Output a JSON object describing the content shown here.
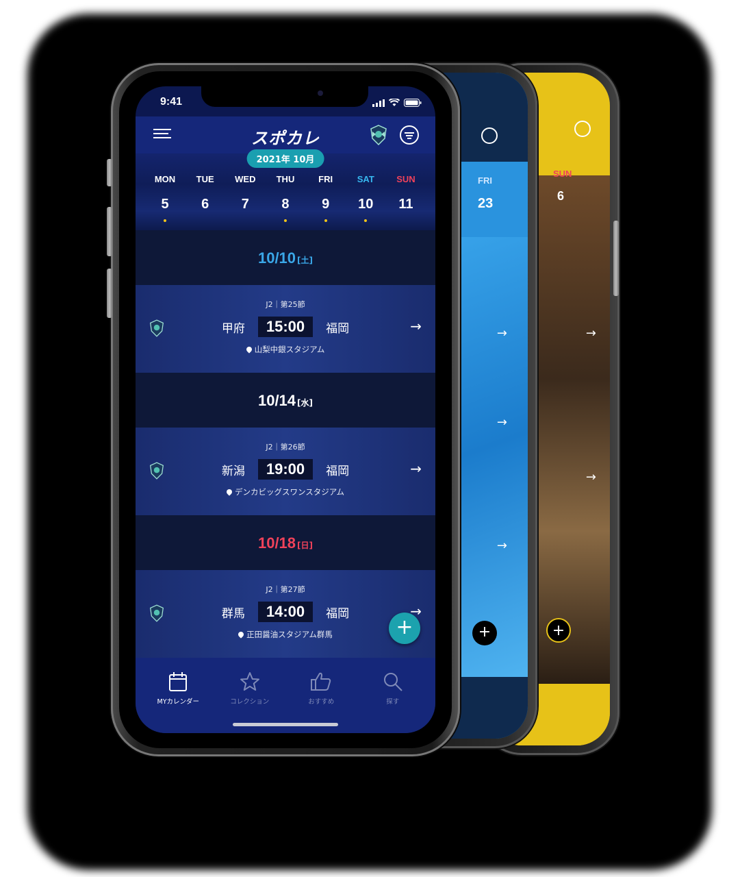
{
  "status": {
    "time": "9:41"
  },
  "app": {
    "logo_text": "スポカレ"
  },
  "calendar": {
    "month_label": "2021年 10月",
    "weekdays": [
      "MON",
      "TUE",
      "WED",
      "THU",
      "FRI",
      "SAT",
      "SUN"
    ],
    "dates": [
      "5",
      "6",
      "7",
      "8",
      "9",
      "10",
      "11"
    ],
    "selected": "8"
  },
  "schedule": [
    {
      "date": "10/10",
      "day": "[土]",
      "league": "J2｜第25節",
      "home": "甲府",
      "time": "15:00",
      "away": "福岡",
      "venue": "山梨中銀スタジアム"
    },
    {
      "date": "10/14",
      "day": "[水]",
      "league": "J2｜第26節",
      "home": "新潟",
      "time": "19:00",
      "away": "福岡",
      "venue": "デンカビッグスワンスタジアム"
    },
    {
      "date": "10/18",
      "day": "[日]",
      "league": "J2｜第27節",
      "home": "群馬",
      "time": "14:00",
      "away": "福岡",
      "venue": "正田醤油スタジアム群馬"
    }
  ],
  "tabs": [
    {
      "label": "MYカレンダー",
      "icon": "calendar-icon",
      "active": true
    },
    {
      "label": "コレクション",
      "icon": "star-icon",
      "active": false
    },
    {
      "label": "おすすめ",
      "icon": "thumbs-up-icon",
      "active": false
    },
    {
      "label": "探す",
      "icon": "search-icon",
      "active": false
    }
  ],
  "back_phones": {
    "blue": {
      "weekday": "FRI",
      "date": "23",
      "color": "#1f86d6"
    },
    "yellow": {
      "weekday": "SUN",
      "date": "6",
      "color": "#e7c218"
    }
  },
  "colors": {
    "primary": "#15277a",
    "accent": "#1ca2ae",
    "saturday": "#37b8f0",
    "sunday": "#f0425a",
    "event_dot": "#f2c418"
  }
}
